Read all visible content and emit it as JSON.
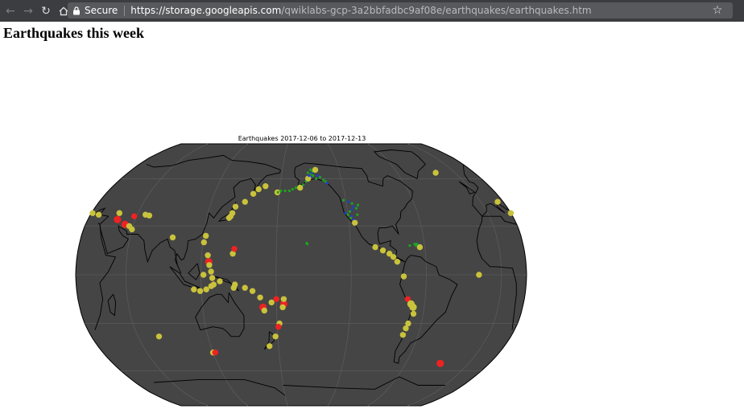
{
  "browser": {
    "secure_label": "Secure",
    "url_host": "https://storage.googleapis.com",
    "url_path": "/qwiklabs-gcp-3a2bbfadbc9af08e/earthquakes/earthquakes.htm",
    "icons": [
      "back-icon",
      "forward-icon",
      "reload-icon",
      "home-icon",
      "lock-icon",
      "star-icon"
    ]
  },
  "page": {
    "heading": "Earthquakes this week"
  },
  "map": {
    "title": "Earthquakes 2017-12-06 to 2017-12-13",
    "projection": "robinson",
    "ocean_color": "#454545",
    "coastline_color": "#000000",
    "graticule_color": "#5a5a5a",
    "central_longitude": -160,
    "magnitude_colors": {
      "small_blue": "#1f3fcf",
      "small_green": "#1fa31f",
      "medium_yellow": "#c9c23c",
      "large_red": "#ee2222"
    },
    "quakes": [
      {
        "lat": 8,
        "lon": 126,
        "c": "large_red",
        "s": 3
      },
      {
        "lat": 6,
        "lon": 126.5,
        "c": "medium_yellow",
        "s": 2
      },
      {
        "lat": 12,
        "lon": 125,
        "c": "medium_yellow",
        "s": 2
      },
      {
        "lat": 20,
        "lon": 121,
        "c": "medium_yellow",
        "s": 2
      },
      {
        "lat": 24,
        "lon": 122,
        "c": "medium_yellow",
        "s": 2
      },
      {
        "lat": 38,
        "lon": 141,
        "c": "medium_yellow",
        "s": 2
      },
      {
        "lat": 36,
        "lon": 140,
        "c": "medium_yellow",
        "s": 2
      },
      {
        "lat": 35,
        "lon": 139,
        "c": "medium_yellow",
        "s": 2
      },
      {
        "lat": 42,
        "lon": 142.5,
        "c": "medium_yellow",
        "s": 2
      },
      {
        "lat": 45,
        "lon": 150,
        "c": "medium_yellow",
        "s": 2
      },
      {
        "lat": 50,
        "lon": 156,
        "c": "medium_yellow",
        "s": 2
      },
      {
        "lat": 53,
        "lon": 160,
        "c": "medium_yellow",
        "s": 2
      },
      {
        "lat": 55,
        "lon": 166,
        "c": "medium_yellow",
        "s": 2
      },
      {
        "lat": 51,
        "lon": 178,
        "c": "medium_yellow",
        "s": 2
      },
      {
        "lat": 13,
        "lon": 145,
        "c": "medium_yellow",
        "s": 2
      },
      {
        "lat": 16,
        "lon": 146,
        "c": "large_red",
        "s": 2
      },
      {
        "lat": 2,
        "lon": 128,
        "c": "medium_yellow",
        "s": 2
      },
      {
        "lat": 0,
        "lon": 122,
        "c": "medium_yellow",
        "s": 2
      },
      {
        "lat": -2,
        "lon": 129,
        "c": "medium_yellow",
        "s": 2
      },
      {
        "lat": -4,
        "lon": 135,
        "c": "medium_yellow",
        "s": 2
      },
      {
        "lat": -6,
        "lon": 130,
        "c": "medium_yellow",
        "s": 2
      },
      {
        "lat": -7,
        "lon": 128,
        "c": "medium_yellow",
        "s": 2
      },
      {
        "lat": -9,
        "lon": 124,
        "c": "medium_yellow",
        "s": 2
      },
      {
        "lat": -10,
        "lon": 119,
        "c": "medium_yellow",
        "s": 2
      },
      {
        "lat": -9,
        "lon": 114,
        "c": "medium_yellow",
        "s": 2
      },
      {
        "lat": -6,
        "lon": 147,
        "c": "medium_yellow",
        "s": 2
      },
      {
        "lat": -8,
        "lon": 146,
        "c": "medium_yellow",
        "s": 2
      },
      {
        "lat": -8,
        "lon": 155,
        "c": "medium_yellow",
        "s": 2
      },
      {
        "lat": -10,
        "lon": 161,
        "c": "medium_yellow",
        "s": 2
      },
      {
        "lat": -14,
        "lon": 167,
        "c": "medium_yellow",
        "s": 2
      },
      {
        "lat": -20,
        "lon": 169,
        "c": "large_red",
        "s": 3
      },
      {
        "lat": -22,
        "lon": 170,
        "c": "medium_yellow",
        "s": 2
      },
      {
        "lat": -17,
        "lon": 176,
        "c": "medium_yellow",
        "s": 2
      },
      {
        "lat": -15,
        "lon": 180,
        "c": "large_red",
        "s": 2
      },
      {
        "lat": -18,
        "lon": 186,
        "c": "large_red",
        "s": 3
      },
      {
        "lat": -20,
        "lon": 185,
        "c": "medium_yellow",
        "s": 2
      },
      {
        "lat": -15,
        "lon": 186,
        "c": "medium_yellow",
        "s": 2
      },
      {
        "lat": -30,
        "lon": 182,
        "c": "medium_yellow",
        "s": 2
      },
      {
        "lat": -32,
        "lon": 181,
        "c": "large_red",
        "s": 2
      },
      {
        "lat": -38,
        "lon": 178,
        "c": "medium_yellow",
        "s": 2
      },
      {
        "lat": -44,
        "lon": 172,
        "c": "medium_yellow",
        "s": 2
      },
      {
        "lat": -48,
        "lon": 120,
        "c": "medium_yellow",
        "s": 2
      },
      {
        "lat": -48,
        "lon": 122,
        "c": "large_red",
        "s": 2
      },
      {
        "lat": 60,
        "lon": -152,
        "c": "small_green",
        "s": 1
      },
      {
        "lat": 61,
        "lon": -150,
        "c": "small_blue",
        "s": 1
      },
      {
        "lat": 62,
        "lon": -148,
        "c": "small_green",
        "s": 1
      },
      {
        "lat": 63,
        "lon": -150,
        "c": "small_green",
        "s": 1
      },
      {
        "lat": 64,
        "lon": -149,
        "c": "small_blue",
        "s": 1
      },
      {
        "lat": 65,
        "lon": -148,
        "c": "small_green",
        "s": 1
      },
      {
        "lat": 66,
        "lon": -150,
        "c": "small_green",
        "s": 1
      },
      {
        "lat": 60,
        "lon": -145,
        "c": "small_green",
        "s": 1
      },
      {
        "lat": 61,
        "lon": -141,
        "c": "small_green",
        "s": 1
      },
      {
        "lat": 62,
        "lon": -143,
        "c": "small_blue",
        "s": 1
      },
      {
        "lat": 59,
        "lon": -138,
        "c": "small_green",
        "s": 1
      },
      {
        "lat": 58,
        "lon": -136,
        "c": "small_green",
        "s": 1
      },
      {
        "lat": 57,
        "lon": -135,
        "c": "small_blue",
        "s": 1
      },
      {
        "lat": 58,
        "lon": -155,
        "c": "small_green",
        "s": 1
      },
      {
        "lat": 56,
        "lon": -158,
        "c": "small_green",
        "s": 1
      },
      {
        "lat": 55,
        "lon": -162,
        "c": "small_green",
        "s": 1
      },
      {
        "lat": 54,
        "lon": -165,
        "c": "small_green",
        "s": 1
      },
      {
        "lat": 53,
        "lon": -168,
        "c": "small_green",
        "s": 1
      },
      {
        "lat": 52,
        "lon": -171,
        "c": "small_green",
        "s": 1
      },
      {
        "lat": 52,
        "lon": -175,
        "c": "small_green",
        "s": 1
      },
      {
        "lat": 52,
        "lon": -179,
        "c": "small_green",
        "s": 1
      },
      {
        "lat": 51,
        "lon": 178.5,
        "c": "small_green",
        "s": 1
      },
      {
        "lat": 54,
        "lon": -161,
        "c": "medium_yellow",
        "s": 2
      },
      {
        "lat": 60,
        "lon": -153,
        "c": "medium_yellow",
        "s": 2
      },
      {
        "lat": 66,
        "lon": -145,
        "c": "medium_yellow",
        "s": 2
      },
      {
        "lat": 62,
        "lon": -152,
        "c": "small_blue",
        "s": 1
      },
      {
        "lat": 64,
        "lon": -153,
        "c": "small_green",
        "s": 1
      },
      {
        "lat": 46,
        "lon": -122,
        "c": "small_green",
        "s": 1
      },
      {
        "lat": 45,
        "lon": -118,
        "c": "small_blue",
        "s": 1
      },
      {
        "lat": 44,
        "lon": -115,
        "c": "small_green",
        "s": 1
      },
      {
        "lat": 42,
        "lon": -114,
        "c": "small_blue",
        "s": 1
      },
      {
        "lat": 40,
        "lon": -116,
        "c": "small_blue",
        "s": 1
      },
      {
        "lat": 39,
        "lon": -118,
        "c": "small_green",
        "s": 1
      },
      {
        "lat": 38,
        "lon": -122,
        "c": "small_blue",
        "s": 1
      },
      {
        "lat": 37,
        "lon": -120,
        "c": "small_green",
        "s": 1
      },
      {
        "lat": 36,
        "lon": -117,
        "c": "small_blue",
        "s": 1
      },
      {
        "lat": 35,
        "lon": -118,
        "c": "small_green",
        "s": 1
      },
      {
        "lat": 34,
        "lon": -116,
        "c": "small_blue",
        "s": 1
      },
      {
        "lat": 33,
        "lon": -115,
        "c": "small_green",
        "s": 1
      },
      {
        "lat": 41,
        "lon": -112,
        "c": "small_green",
        "s": 1
      },
      {
        "lat": 43,
        "lon": -110,
        "c": "small_green",
        "s": 1
      },
      {
        "lat": 37,
        "lon": -112,
        "c": "small_green",
        "s": 1
      },
      {
        "lat": 19,
        "lon": -155,
        "c": "small_green",
        "s": 1
      },
      {
        "lat": 19.5,
        "lon": -155.5,
        "c": "small_green",
        "s": 1
      },
      {
        "lat": 32,
        "lon": -115,
        "c": "medium_yellow",
        "s": 2
      },
      {
        "lat": 17,
        "lon": -100,
        "c": "medium_yellow",
        "s": 2
      },
      {
        "lat": 15,
        "lon": -94,
        "c": "medium_yellow",
        "s": 2
      },
      {
        "lat": 13,
        "lon": -89,
        "c": "medium_yellow",
        "s": 2
      },
      {
        "lat": 11,
        "lon": -86,
        "c": "medium_yellow",
        "s": 2
      },
      {
        "lat": 8,
        "lon": -83,
        "c": "medium_yellow",
        "s": 2
      },
      {
        "lat": 18,
        "lon": -67,
        "c": "small_green",
        "s": 1
      },
      {
        "lat": 18.5,
        "lon": -65,
        "c": "small_blue",
        "s": 1
      },
      {
        "lat": 19,
        "lon": -66,
        "c": "small_green",
        "s": 1
      },
      {
        "lat": 17,
        "lon": -64,
        "c": "medium_yellow",
        "s": 2
      },
      {
        "lat": 19,
        "lon": -68,
        "c": "small_green",
        "s": 1
      },
      {
        "lat": 18,
        "lon": -72,
        "c": "small_green",
        "s": 1
      },
      {
        "lat": -1,
        "lon": -78,
        "c": "medium_yellow",
        "s": 2
      },
      {
        "lat": -15,
        "lon": -74,
        "c": "large_red",
        "s": 2
      },
      {
        "lat": -18,
        "lon": -71,
        "c": "medium_yellow",
        "s": 3
      },
      {
        "lat": -20,
        "lon": -69,
        "c": "medium_yellow",
        "s": 3
      },
      {
        "lat": -24,
        "lon": -68,
        "c": "medium_yellow",
        "s": 2
      },
      {
        "lat": -30,
        "lon": -71,
        "c": "medium_yellow",
        "s": 2
      },
      {
        "lat": -33,
        "lon": -72,
        "c": "medium_yellow",
        "s": 2
      },
      {
        "lat": -37,
        "lon": -73,
        "c": "medium_yellow",
        "s": 2
      },
      {
        "lat": -55,
        "lon": -27,
        "c": "large_red",
        "s": 3
      },
      {
        "lat": 0,
        "lon": -18,
        "c": "medium_yellow",
        "s": 2
      },
      {
        "lat": 64,
        "lon": -20,
        "c": "medium_yellow",
        "s": 2
      },
      {
        "lat": 45,
        "lon": 15,
        "c": "medium_yellow",
        "s": 2
      },
      {
        "lat": 38,
        "lon": 20,
        "c": "medium_yellow",
        "s": 2
      },
      {
        "lat": 37,
        "lon": 27,
        "c": "medium_yellow",
        "s": 2
      },
      {
        "lat": 38,
        "lon": 21,
        "c": "medium_yellow",
        "s": 2
      },
      {
        "lat": 38,
        "lon": 44,
        "c": "medium_yellow",
        "s": 2
      },
      {
        "lat": 34,
        "lon": 45,
        "c": "large_red",
        "s": 3
      },
      {
        "lat": 31,
        "lon": 53,
        "c": "large_red",
        "s": 3
      },
      {
        "lat": 36,
        "lon": 58,
        "c": "large_red",
        "s": 2
      },
      {
        "lat": 36.5,
        "lon": 70.5,
        "c": "medium_yellow",
        "s": 2
      },
      {
        "lat": 30,
        "lon": 57,
        "c": "medium_yellow",
        "s": 2
      },
      {
        "lat": 28,
        "lon": 60,
        "c": "medium_yellow",
        "s": 2
      },
      {
        "lat": 37,
        "lon": 67,
        "c": "medium_yellow",
        "s": 2
      },
      {
        "lat": 23,
        "lon": 95,
        "c": "medium_yellow",
        "s": 2
      },
      {
        "lat": -38,
        "lon": 78,
        "c": "medium_yellow",
        "s": 2
      }
    ]
  }
}
